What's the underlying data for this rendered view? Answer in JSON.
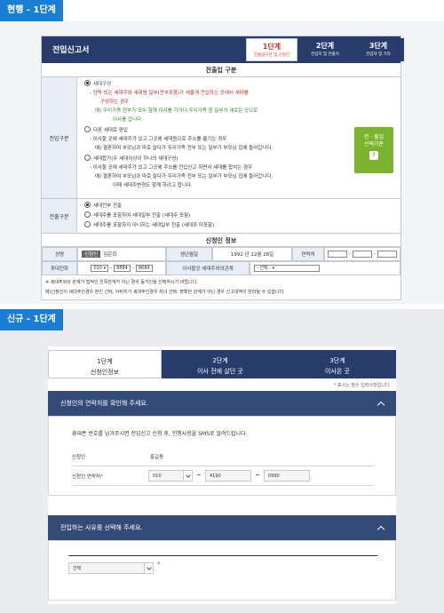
{
  "current": {
    "section_label": "현행 - 1단계",
    "form_title": "전입신고서",
    "steps": [
      {
        "num": "1단계",
        "sub": "전출입구분 및 신청인"
      },
      {
        "num": "2단계",
        "sub": "전입지 및 전출지"
      },
      {
        "num": "3단계",
        "sub": "전입자 및 기타"
      }
    ],
    "move_section_title": "전출입 구분",
    "move_label": "전입구분",
    "move_opts": [
      "세대구성",
      "- 단독 또는 세대주와 세대원 일부(전부포함)가 새롭게 전입하는 곳에서 세대를",
      "구성하는 경우",
      "예) 우리가족 전부가 모두 함께 이사를 가거나 우리가족 중 일부가 새로운 곳으로",
      "이사를 갑니다.",
      "다른 세대로 편입",
      "- 이사할 곳에 세대주가 있고 그곳에 세대원으로 주소를 옮기는 경우",
      "예) 결혼하여 부모님과 따로 살다가 우리가족 전부 또는 일부가 부모님 집에 들어갑니다.",
      "세대합가(두 세대이상이 하나의 세대구성)",
      "- 이사할 곳에 세대주가 있고 그곳에 주소를 전입신고 하면서 세대를 합치는 경우",
      "예) 결혼하여 부모님과 따로 살다가 우리가족 전부 또는 일부가 부모님 집에 들어갑니다.",
      "이때 세대주변경도 함께 하려고 합니다."
    ],
    "side_button": {
      "line1": "전 · 출입",
      "line2": "선택기준",
      "q": "?"
    },
    "out_label": "전출구분",
    "out_opts": [
      "세대전부 전출",
      "세대주를 포함하여 세대일부 전출 (세대주 포함)",
      "세대주를 포함하지 아니하는 세대일부 전출 (세대주 미포함)"
    ],
    "applicant_title": "신청인 정보",
    "grid": {
      "name_h": "성명",
      "name_btn": "신청인",
      "name_v": "김은희",
      "birth_h": "생년월일",
      "birth_v": "1992 년 12월 28일",
      "contact_h": "연락처",
      "phone_h": "휴대전화",
      "phone1": "010",
      "phone2": "8884",
      "phone3": "8684",
      "rel_h": "이사할곳 세대주와의관계",
      "rel_v": "- 선택 -"
    },
    "notes": [
      "※ 세대주와의 관계가 법적인 친족관계가 아닌 경우 동거인을 선택하시기 바랍니다.",
      "예)신청인이 세대주인경우 본인 선택, 아버지가 세대주인경우 자녀 선택. 명확한 관계가 아닌 경우 신고내역이 반려될 수 있습니다."
    ]
  },
  "new": {
    "section_label": "신규 - 1단계",
    "tabs": [
      {
        "num": "1단계",
        "sub": "신청인정보"
      },
      {
        "num": "2단계",
        "sub": "이사 전에 살던 곳"
      },
      {
        "num": "3단계",
        "sub": "이사온 곳"
      }
    ],
    "required_note": "표시는 필수 입력사항입니다.",
    "required_mark": "*",
    "panel1_title": "신청인의 연락처를 확인해 주세요.",
    "panel1_info": "휴대폰 번호를 남겨주시면 전입신고 신청 후, 진행사항을 SMS로 알려드립니다.",
    "applicant_k": "신청인",
    "applicant_v": "홍길동",
    "contact_k": "신청인 연락처",
    "phone1": "010",
    "phone2": "4190",
    "phone3": "0990",
    "panel2_title": "전입하는 사유를 선택해 주세요.",
    "reason_v": "선택"
  }
}
